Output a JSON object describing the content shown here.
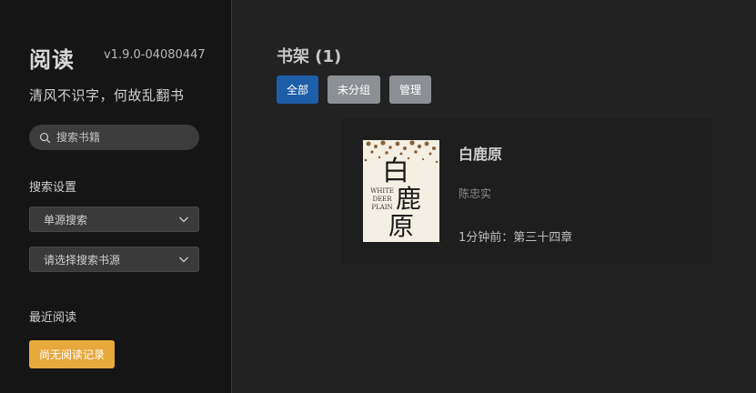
{
  "sidebar": {
    "app_title": "阅读",
    "version": "v1.9.0-04080447",
    "motto": "清风不识字，何故乱翻书",
    "search": {
      "placeholder": "搜索书籍",
      "icon": "search-icon"
    },
    "search_settings_label": "搜索设置",
    "source_mode_select": "单源搜索",
    "source_select": "请选择搜索书源",
    "recent_reading_label": "最近阅读",
    "no_history_button": "尚无阅读记录"
  },
  "main": {
    "title": "书架 (1)",
    "tabs": [
      {
        "label": "全部",
        "active": true
      },
      {
        "label": "未分组",
        "active": false
      },
      {
        "label": "管理",
        "active": false
      }
    ],
    "books": [
      {
        "name": "白鹿原",
        "author": "陈忠实",
        "progress": "1分钟前：第三十四章",
        "cover": {
          "title_chars": [
            "白",
            "鹿",
            "原"
          ],
          "english_lines": [
            "WHITE",
            "DEER",
            "PLAIN"
          ]
        }
      }
    ]
  },
  "colors": {
    "sidebar_bg": "#151515",
    "main_bg": "#222222",
    "card_bg": "#1e1e1e",
    "tab_active": "#1d5ea8",
    "tab_inactive": "#8c8f94",
    "history_button": "#e7a83c"
  }
}
